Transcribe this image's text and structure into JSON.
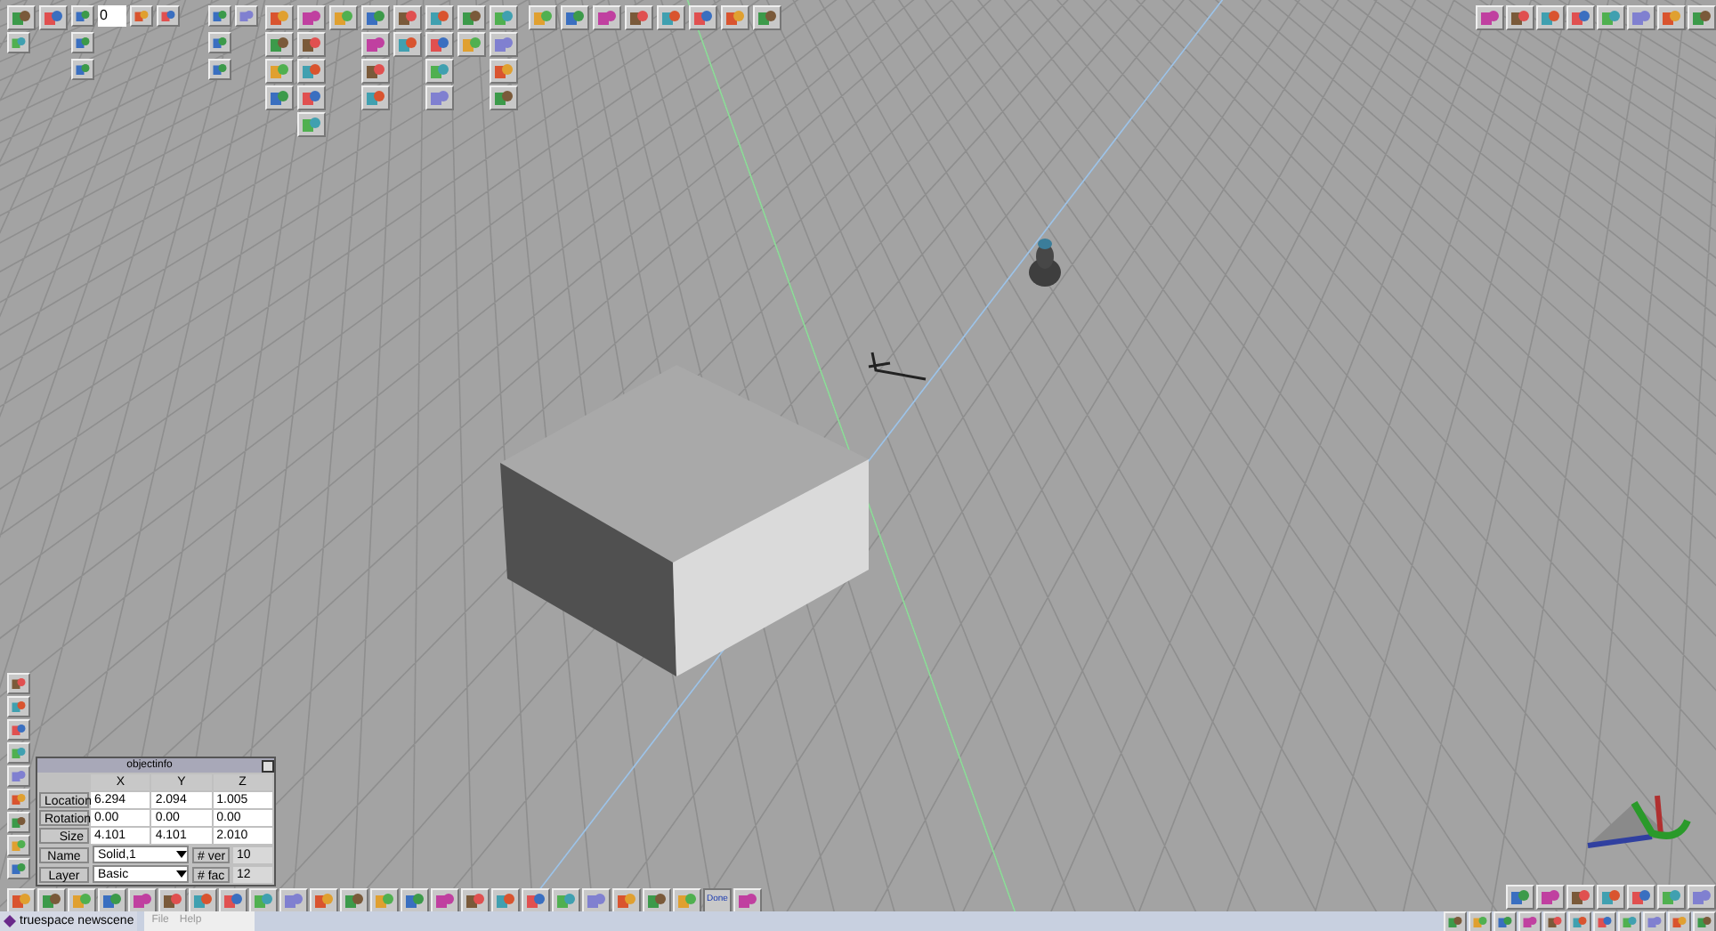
{
  "timeline": {
    "frame": "0"
  },
  "object_info": {
    "title": "objectinfo",
    "columns": [
      "X",
      "Y",
      "Z"
    ],
    "rows": [
      {
        "label": "Location",
        "values": [
          "6.294",
          "2.094",
          "1.005"
        ]
      },
      {
        "label": "Rotation",
        "values": [
          "0.00",
          "0.00",
          "0.00"
        ]
      },
      {
        "label": "Size",
        "values": [
          "4.101",
          "4.101",
          "2.010"
        ]
      }
    ],
    "name": {
      "label": "Name",
      "value": "Solid,1"
    },
    "vertices": {
      "label": "# ver",
      "value": "10"
    },
    "layer": {
      "label": "Layer",
      "value": "Basic"
    },
    "faces": {
      "label": "# fac",
      "value": "12"
    }
  },
  "bottom_toolbar": {
    "done_label": "Done"
  },
  "taskbar": {
    "window_title": "truespace newscene"
  },
  "menu": [
    "File",
    "Help"
  ]
}
